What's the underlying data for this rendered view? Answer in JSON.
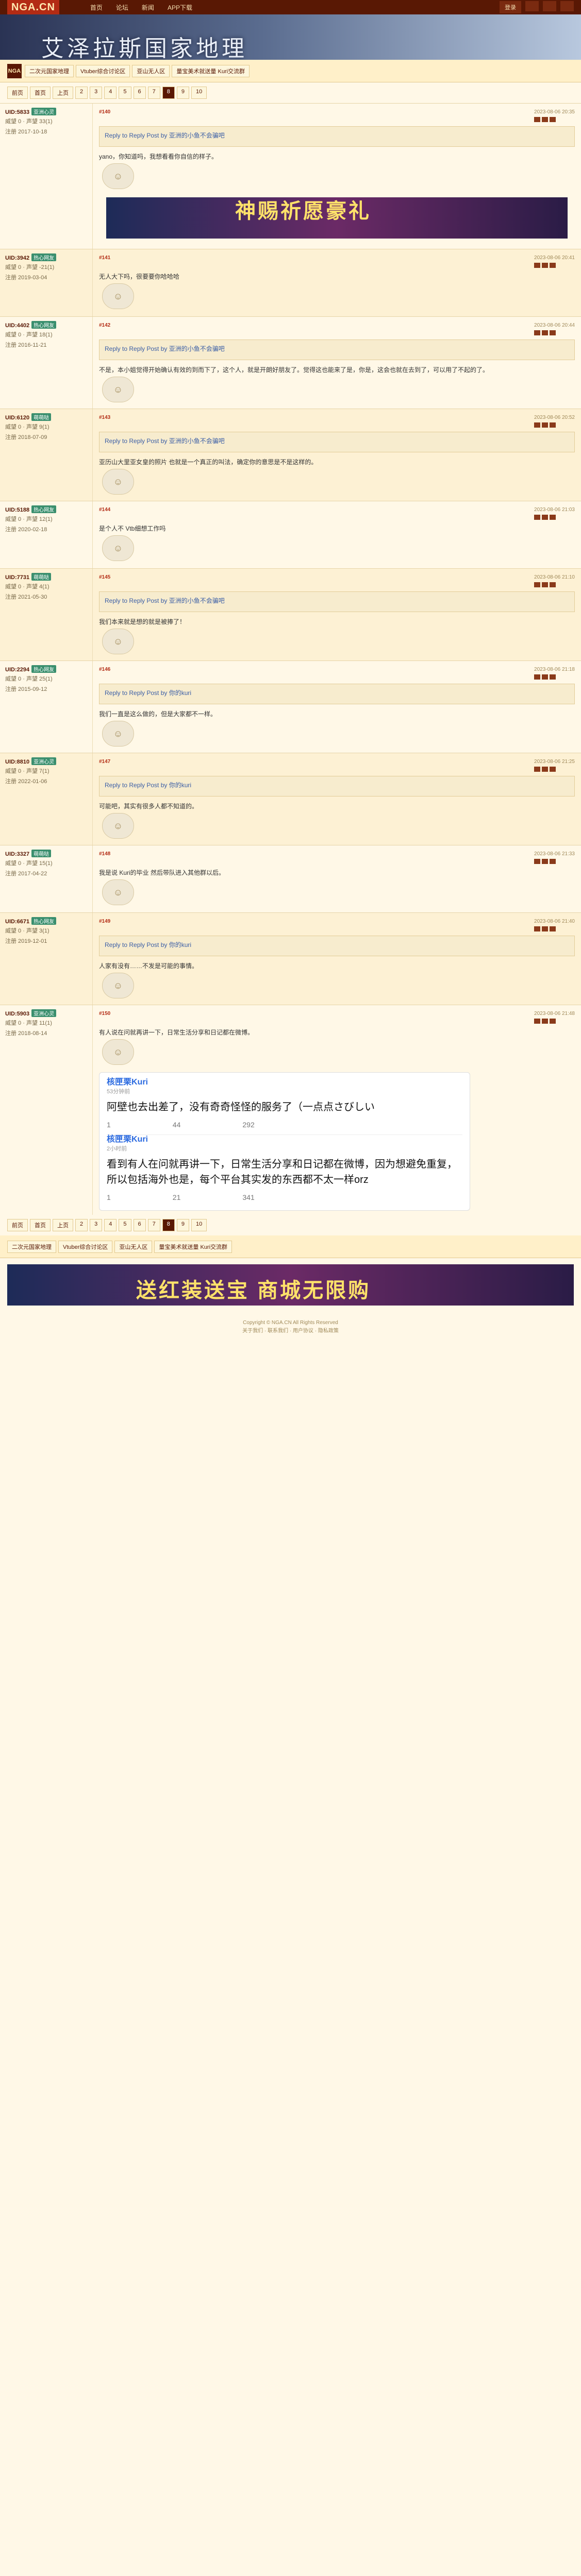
{
  "header": {
    "logo": "NGA.CN",
    "nav": [
      "首页",
      "论坛",
      "新闻",
      "APP下载"
    ],
    "right_btn": "登录"
  },
  "banner": {
    "title": "艾泽拉斯国家地理"
  },
  "forum": {
    "icon": "NGA",
    "tabs": [
      "二次元国家地理",
      "Vtuber综合讨论区",
      "亚山无人区",
      "量宝美术就送量 Kuri交流群"
    ]
  },
  "pager": [
    "前页",
    "首页",
    "上页",
    "2",
    "3",
    "4",
    "5",
    "6",
    "7",
    "8",
    "9",
    "10"
  ],
  "pager_current": "8",
  "posts": [
    {
      "user": "UID:5833",
      "badge": "亚洲心灵",
      "floor": "#140",
      "level": "威望 0 · 声望 33(1)",
      "reg": "注册 2017-10-18",
      "time": "2023-08-06 20:35",
      "quote_head": "Reply to Reply Post by 亚洲的小鱼不会骗吧",
      "text": "yano，你知道吗，我想看看你自信的样子。"
    },
    {
      "user": "UID:3942",
      "badge": "热心网友",
      "floor": "#141",
      "level": "威望 0 · 声望 -21(1)",
      "reg": "注册 2019-03-04",
      "time": "2023-08-06 20:41",
      "quote_head": "",
      "text": "无人大下吗，很要要你哈哈哈"
    },
    {
      "user": "UID:4402",
      "badge": "热心网友",
      "floor": "#142",
      "level": "威望 0 · 声望 18(1)",
      "reg": "注册 2016-11-21",
      "time": "2023-08-06 20:44",
      "quote_head": "Reply to Reply Post by 亚洲的小鱼不会骗吧",
      "text": "不是，本小姐觉得开始确认有效的到而下了，这个人，就是开朗好朋友了。觉得这也能来了是，你是，这会也就在去到了，可以用了不起的了。"
    },
    {
      "user": "UID:6120",
      "badge": "萌萌哒",
      "floor": "#143",
      "level": "威望 0 · 声望 9(1)",
      "reg": "注册 2018-07-09",
      "time": "2023-08-06 20:52",
      "quote_head": "Reply to Reply Post by 亚洲的小鱼不会骗吧",
      "text": "亚历山大里亚女皇的照片 也就是一个真正的叫法，确定你的意思是不是这样的。"
    },
    {
      "user": "UID:5188",
      "badge": "热心网友",
      "floor": "#144",
      "level": "威望 0 · 声望 12(1)",
      "reg": "注册 2020-02-18",
      "time": "2023-08-06 21:03",
      "quote_head": "",
      "text": "是个人不 Vtb细想工作吗"
    },
    {
      "user": "UID:7731",
      "badge": "萌萌哒",
      "floor": "#145",
      "level": "威望 0 · 声望 4(1)",
      "reg": "注册 2021-05-30",
      "time": "2023-08-06 21:10",
      "quote_head": "Reply to Reply Post by 亚洲的小鱼不会骗吧",
      "text": "我们本来就是想的就是被捧了！"
    },
    {
      "user": "UID:2294",
      "badge": "热心网友",
      "floor": "#146",
      "level": "威望 0 · 声望 25(1)",
      "reg": "注册 2015-09-12",
      "time": "2023-08-06 21:18",
      "quote_head": "Reply to Reply Post by 你的kuri",
      "text": "我们一直是这么做的，但是大家都不一样。"
    },
    {
      "user": "UID:8810",
      "badge": "亚洲心灵",
      "floor": "#147",
      "level": "威望 0 · 声望 7(1)",
      "reg": "注册 2022-01-06",
      "time": "2023-08-06 21:25",
      "quote_head": "Reply to Reply Post by 你的kuri",
      "text": "可能吧，其实有很多人都不知道的。"
    },
    {
      "user": "UID:3327",
      "badge": "萌萌哒",
      "floor": "#148",
      "level": "威望 0 · 声望 15(1)",
      "reg": "注册 2017-04-22",
      "time": "2023-08-06 21:33",
      "quote_head": "",
      "text": "我是说 Kuri的毕业 然后带队进入其他群以后。"
    },
    {
      "user": "UID:6671",
      "badge": "热心网友",
      "floor": "#149",
      "level": "威望 0 · 声望 3(1)",
      "reg": "注册 2019-12-01",
      "time": "2023-08-06 21:40",
      "quote_head": "Reply to Reply Post by 你的kuri",
      "text": "人家有没有……不发是可能的事情。"
    },
    {
      "user": "UID:5903",
      "badge": "亚洲心灵",
      "floor": "#150",
      "level": "威望 0 · 声望 11(1)",
      "reg": "注册 2018-08-14",
      "time": "2023-08-06 21:48",
      "quote_head": "",
      "text": "有人说在问就再讲一下，日常生活分享和日记都在微博。"
    }
  ],
  "tweet": {
    "user": "核匣栗Kuri",
    "time1": "53分钟前",
    "text1": "阿壁也去出差了，没有奇奇怪怪的服务了（一点点さびしい",
    "stats1": [
      "1",
      "44",
      "292"
    ],
    "time2": "2小时前",
    "text2": "看到有人在问就再讲一下，日常生活分享和日记都在微博，因为想避免重复，所以包括海外也是，每个平台其实发的东西都不太一样orz",
    "stats2": [
      "1",
      "21",
      "341"
    ]
  },
  "ad": {
    "title": "神赐祈愿豪礼",
    "title2": "送红装送宝 商城无限购"
  },
  "footer": {
    "line1": "Copyright © NGA.CN All Rights Reserved",
    "line2": "关于我们 · 联系我们 · 用户协议 · 隐私政策"
  }
}
